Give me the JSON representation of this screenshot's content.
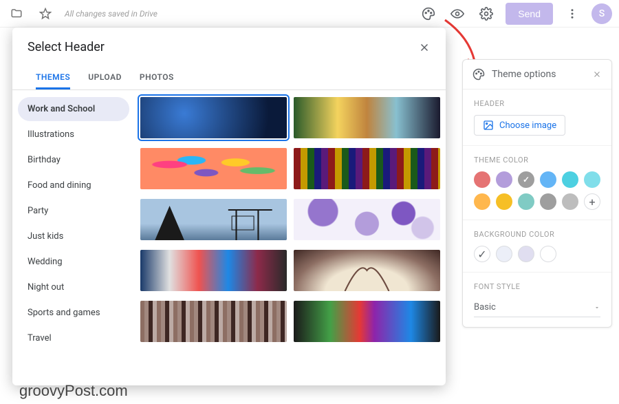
{
  "topbar": {
    "saved_text": "All changes saved in Drive",
    "send_label": "Send",
    "avatar_letter": "S"
  },
  "dialog": {
    "title": "Select Header",
    "tabs": [
      {
        "label": "THEMES",
        "active": true
      },
      {
        "label": "UPLOAD",
        "active": false
      },
      {
        "label": "PHOTOS",
        "active": false
      }
    ],
    "categories": [
      {
        "label": "Work and School",
        "active": true
      },
      {
        "label": "Illustrations",
        "active": false
      },
      {
        "label": "Birthday",
        "active": false
      },
      {
        "label": "Food and dining",
        "active": false
      },
      {
        "label": "Party",
        "active": false
      },
      {
        "label": "Just kids",
        "active": false
      },
      {
        "label": "Wedding",
        "active": false
      },
      {
        "label": "Night out",
        "active": false
      },
      {
        "label": "Sports and games",
        "active": false
      },
      {
        "label": "Travel",
        "active": false
      }
    ]
  },
  "theme_panel": {
    "title": "Theme options",
    "header_label": "HEADER",
    "choose_image_label": "Choose image",
    "theme_color_label": "THEME COLOR",
    "theme_colors": [
      {
        "hex": "#e57373"
      },
      {
        "hex": "#b39ddb"
      },
      {
        "hex": "#9e9e9e",
        "selected": true
      },
      {
        "hex": "#64b5f6"
      },
      {
        "hex": "#4dd0e1"
      },
      {
        "hex": "#4dd0e1"
      },
      {
        "hex": "#ffb74d"
      },
      {
        "hex": "#f6bf26"
      },
      {
        "hex": "#80cbc4"
      },
      {
        "hex": "#9e9e9e"
      },
      {
        "hex": "#bdbdbd"
      }
    ],
    "background_label": "BACKGROUND COLOR",
    "background_colors": [
      {
        "hex": "#ffffff",
        "selected": true
      },
      {
        "hex": "#eceff8"
      },
      {
        "hex": "#e0def0"
      },
      {
        "hex": "#ffffff"
      }
    ],
    "font_label": "FONT STYLE",
    "font_value": "Basic"
  },
  "watermark": "groovyPost.com"
}
